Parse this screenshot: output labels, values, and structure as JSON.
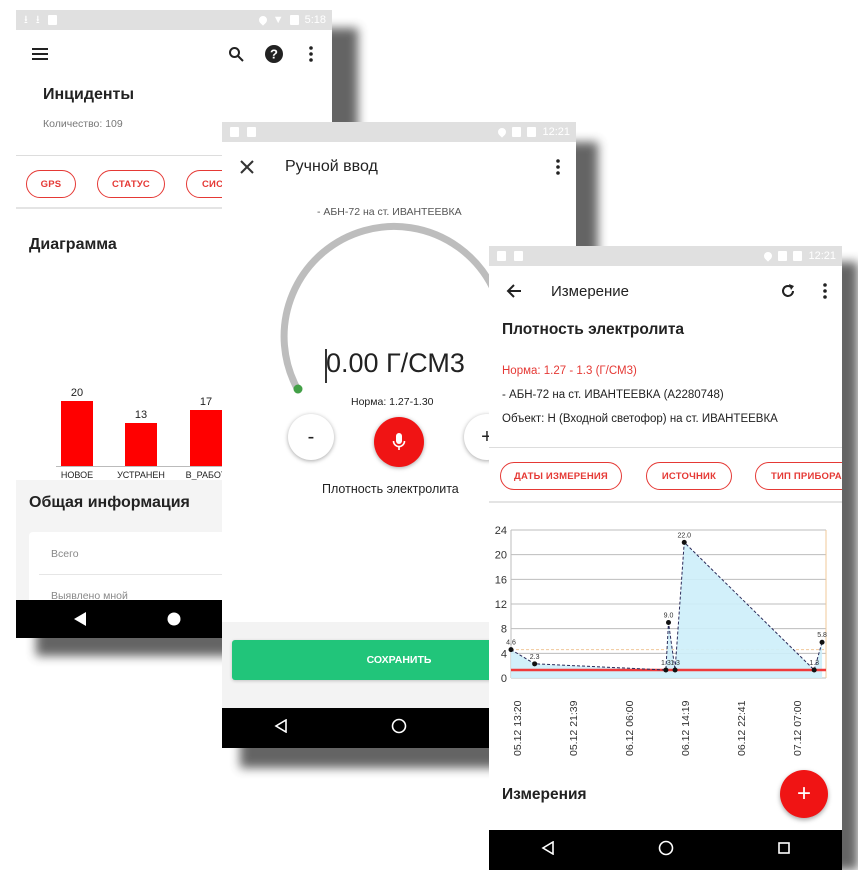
{
  "screen1": {
    "status_time": "5:18",
    "title": "Инциденты",
    "count_label": "Количество: 109",
    "filters": [
      "GPS",
      "СТАТУС",
      "СИСТ"
    ],
    "diagram_title": "Диаграмма",
    "chart_data": {
      "type": "bar",
      "categories": [
        "НОВОЕ",
        "УСТРАНЕН",
        "В_РАБОТ"
      ],
      "values": [
        20,
        13,
        17
      ],
      "ylim": [
        0,
        22
      ]
    },
    "info_title": "Общая информация",
    "info_rows": [
      "Всего",
      "Выявлено мной"
    ]
  },
  "screen2": {
    "status_time": "12:21",
    "title": "Ручной ввод",
    "subtitle": "- АБН-72 на ст. ИВАНТЕЕВКА",
    "value": "0.00 Г/СМ3",
    "norm": "Норма: 1.27-1.30",
    "minus": "-",
    "plus": "+",
    "parameter": "Плотность электролита",
    "save_label": "СОХРАНИТЬ"
  },
  "screen3": {
    "status_time": "12:21",
    "title": "Измерение",
    "parameter_title": "Плотность электролита",
    "norm_text": "Норма: 1.27 - 1.3 (Г/СМ3)",
    "device_text": "- АБН-72 на ст. ИВАНТЕЕВКА (А2280748)",
    "object_text": "Объект: Н (Входной светофор) на ст. ИВАНТЕЕВКА",
    "filters": [
      "ДАТЫ ИЗМЕРЕНИЯ",
      "ИСТОЧНИК",
      "ТИП ПРИБОРА"
    ],
    "measurements_title": "Измерения",
    "fab_label": "+",
    "chart_data": {
      "type": "area",
      "yticks": [
        0,
        4,
        8,
        12,
        16,
        20,
        24
      ],
      "ylim": [
        0,
        24
      ],
      "xticks": [
        "05.12  13:20",
        "05.12  21:39",
        "06.12  06:00",
        "06.12  14:19",
        "06.12  22:41",
        "07.12  07:00"
      ],
      "norm_line": 1.3,
      "band_upper": 4.6,
      "points": [
        {
          "x": 0.0,
          "y": 4.6,
          "label": "4.6"
        },
        {
          "x": 0.9,
          "y": 2.3,
          "label": "2.3"
        },
        {
          "x": 5.9,
          "y": 1.3,
          "label": "1.3"
        },
        {
          "x": 6.0,
          "y": 9.0,
          "label": "9.0"
        },
        {
          "x": 6.25,
          "y": 1.3,
          "label": "1.3"
        },
        {
          "x": 6.6,
          "y": 22.0,
          "label": "22.0"
        },
        {
          "x": 11.55,
          "y": 1.3,
          "label": "1.3"
        },
        {
          "x": 11.85,
          "y": 5.8,
          "label": "5.8"
        }
      ]
    }
  }
}
